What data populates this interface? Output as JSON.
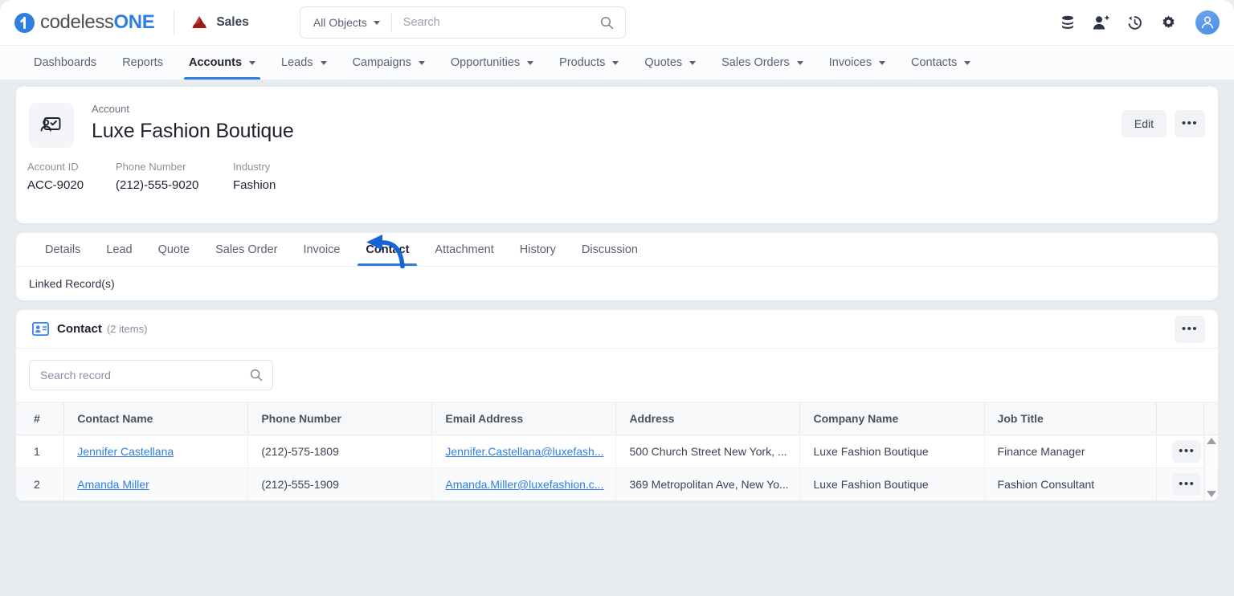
{
  "topbar": {
    "logo_text_a": "codeless",
    "logo_text_b": "ONE",
    "app_name": "Sales",
    "object_filter": "All Objects",
    "search_placeholder": "Search",
    "search_value": "",
    "icons": [
      "database-icon",
      "add-user-icon",
      "history-icon",
      "gear-icon",
      "avatar"
    ]
  },
  "nav": {
    "items": [
      {
        "label": "Dashboards",
        "caret": false,
        "active": false
      },
      {
        "label": "Reports",
        "caret": false,
        "active": false
      },
      {
        "label": "Accounts",
        "caret": true,
        "active": true
      },
      {
        "label": "Leads",
        "caret": true,
        "active": false
      },
      {
        "label": "Campaigns",
        "caret": true,
        "active": false
      },
      {
        "label": "Opportunities",
        "caret": true,
        "active": false
      },
      {
        "label": "Products",
        "caret": true,
        "active": false
      },
      {
        "label": "Quotes",
        "caret": true,
        "active": false
      },
      {
        "label": "Sales Orders",
        "caret": true,
        "active": false
      },
      {
        "label": "Invoices",
        "caret": true,
        "active": false
      },
      {
        "label": "Contacts",
        "caret": true,
        "active": false
      }
    ]
  },
  "record": {
    "kicker": "Account",
    "title": "Luxe Fashion Boutique",
    "edit_label": "Edit",
    "more_label": "•••",
    "fields": [
      {
        "label": "Account ID",
        "value": "ACC-9020"
      },
      {
        "label": "Phone Number",
        "value": "(212)-555-9020"
      },
      {
        "label": "Industry",
        "value": "Fashion"
      }
    ]
  },
  "tabs": {
    "items": [
      {
        "label": "Details",
        "active": false
      },
      {
        "label": "Lead",
        "active": false
      },
      {
        "label": "Quote",
        "active": false
      },
      {
        "label": "Sales Order",
        "active": false
      },
      {
        "label": "Invoice",
        "active": false
      },
      {
        "label": "Contact",
        "active": true
      },
      {
        "label": "Attachment",
        "active": false
      },
      {
        "label": "History",
        "active": false
      },
      {
        "label": "Discussion",
        "active": false
      }
    ],
    "linked_records_label": "Linked Record(s)",
    "annotation_color": "#1565d8"
  },
  "list": {
    "icon": "contact-card-icon",
    "title": "Contact",
    "count": "(2 items)",
    "more_label": "•••",
    "search_placeholder": "Search record",
    "search_value": "",
    "columns": [
      "#",
      "Contact Name",
      "Phone Number",
      "Email Address",
      "Address",
      "Company Name",
      "Job Title",
      ""
    ],
    "rows": [
      {
        "index": "1",
        "contact_name": "Jennifer Castellana",
        "phone": "(212)-575-1809",
        "email": "Jennifer.Castellana@luxefash...",
        "address": "500 Church Street New York, ...",
        "company": "Luxe Fashion Boutique",
        "job_title": "Finance Manager",
        "row_more": "•••"
      },
      {
        "index": "2",
        "contact_name": "Amanda Miller",
        "phone": "(212)-555-1909",
        "email": "Amanda.Miller@luxefashion.c...",
        "address": "369 Metropolitan Ave, New Yo...",
        "company": "Luxe Fashion Boutique",
        "job_title": "Fashion Consultant",
        "row_more": "•••"
      }
    ]
  },
  "colors": {
    "accent": "#2f7fe0",
    "link": "#2f7fe0",
    "page_bg": "#e8ecef",
    "card_bg": "#ffffff",
    "sales_icon": "#a01c1c"
  }
}
